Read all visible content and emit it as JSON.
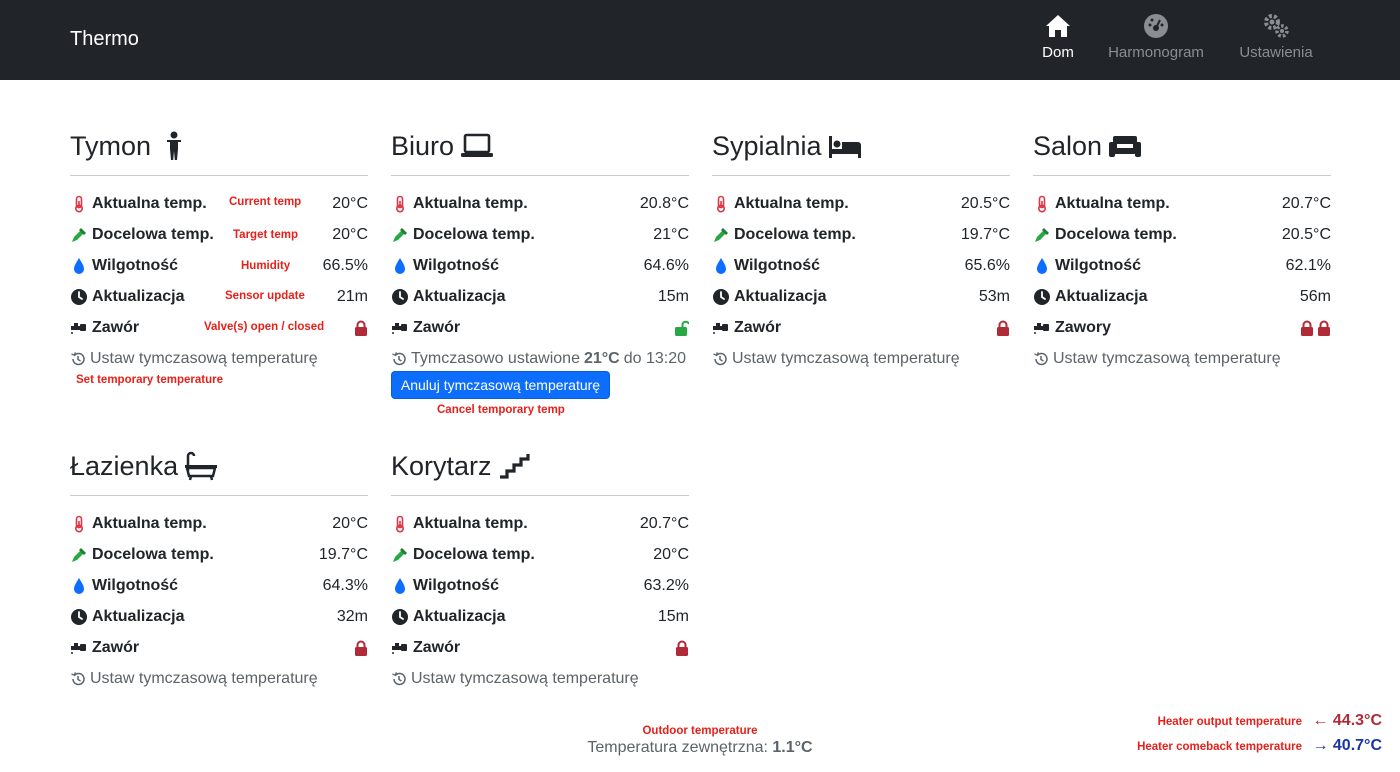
{
  "app": {
    "brand": "Thermo",
    "nav": [
      {
        "label": "Dom",
        "icon": "home-icon",
        "active": true
      },
      {
        "label": "Harmonogram",
        "icon": "gauge-icon",
        "active": false
      },
      {
        "label": "Ustawienia",
        "icon": "gears-icon",
        "active": false
      }
    ]
  },
  "labels": {
    "current": "Aktualna temp.",
    "target": "Docelowa temp.",
    "humidity": "Wilgotność",
    "update": "Aktualizacja",
    "valve": "Zawór",
    "valves": "Zawory",
    "set_temp": "Ustaw tymczasową temperaturę",
    "temp_set_prefix": "Tymczasowo ustawione",
    "temp_set_until": "do 13:20",
    "temp_set_value": "21°C",
    "cancel_button": "Anuluj tymczasową temperaturę"
  },
  "rooms": [
    {
      "name": "Tymon",
      "icon": "child-icon",
      "current": "20°C",
      "target": "20°C",
      "humidity": "66.5%",
      "update": "21m",
      "valve_label": "Zawór",
      "valves": [
        "closed"
      ],
      "temporary": false
    },
    {
      "name": "Biuro",
      "icon": "laptop-icon",
      "current": "20.8°C",
      "target": "21°C",
      "humidity": "64.6%",
      "update": "15m",
      "valve_label": "Zawór",
      "valves": [
        "open"
      ],
      "temporary": true
    },
    {
      "name": "Sypialnia",
      "icon": "bed-icon",
      "current": "20.5°C",
      "target": "19.7°C",
      "humidity": "65.6%",
      "update": "53m",
      "valve_label": "Zawór",
      "valves": [
        "closed"
      ],
      "temporary": false
    },
    {
      "name": "Salon",
      "icon": "couch-icon",
      "current": "20.7°C",
      "target": "20.5°C",
      "humidity": "62.1%",
      "update": "56m",
      "valve_label": "Zawory",
      "valves": [
        "closed",
        "closed"
      ],
      "temporary": false
    },
    {
      "name": "Łazienka",
      "icon": "bath-icon",
      "current": "20°C",
      "target": "19.7°C",
      "humidity": "64.3%",
      "update": "32m",
      "valve_label": "Zawór",
      "valves": [
        "closed"
      ],
      "temporary": false
    },
    {
      "name": "Korytarz",
      "icon": "stairs-icon",
      "current": "20.7°C",
      "target": "20°C",
      "humidity": "63.2%",
      "update": "15m",
      "valve_label": "Zawór",
      "valves": [
        "closed"
      ],
      "temporary": false
    }
  ],
  "annotations": {
    "current_temp": "Current temp",
    "target_temp": "Target temp",
    "humidity": "Humidity",
    "sensor_update": "Sensor update",
    "valves": "Valve(s) open / closed",
    "set_temp": "Set temporary temperature",
    "cancel_temp": "Cancel temporary temp",
    "outdoor": "Outdoor temperature",
    "heater_output": "Heater output temperature",
    "heater_comeback": "Heater comeback temperature"
  },
  "outdoor": {
    "label": "Temperatura zewnętrzna:",
    "value": "1.1°C"
  },
  "heater": {
    "output": {
      "arrow": "←",
      "value": "44.3°C"
    },
    "comeback": {
      "arrow": "→",
      "value": "40.7°C"
    }
  },
  "colors": {
    "navbar": "#212529",
    "thermometer": "#dc3545",
    "eyedropper": "#28a745",
    "droplet": "#0d6efd",
    "lock": "#b02a37",
    "unlock": "#28a745",
    "annotation": "#e8201a",
    "heater_output": "#b02a37",
    "heater_comeback": "#1a34a8",
    "primary_button": "#0d6efd"
  }
}
